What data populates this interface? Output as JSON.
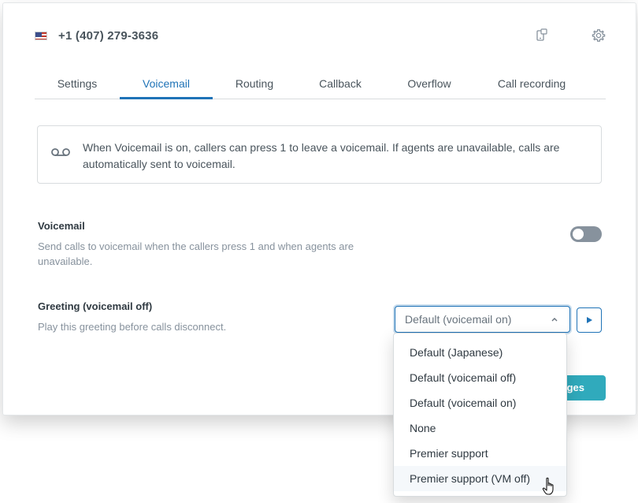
{
  "header": {
    "flag": "us-flag-icon",
    "phone_number": "+1 (407) 279-3636",
    "icons": [
      "mobile-device-icon",
      "gear-icon"
    ]
  },
  "tabs": [
    {
      "label": "Settings",
      "active": false
    },
    {
      "label": "Voicemail",
      "active": true
    },
    {
      "label": "Routing",
      "active": false
    },
    {
      "label": "Callback",
      "active": false
    },
    {
      "label": "Overflow",
      "active": false
    },
    {
      "label": "Call recording",
      "active": false
    }
  ],
  "info": {
    "icon": "voicemail-icon",
    "text": "When Voicemail is on, callers can press 1 to leave a voicemail. If agents are unavailable, calls are automatically sent to voicemail."
  },
  "voicemail_setting": {
    "label": "Voicemail",
    "description": "Send calls to voicemail when the callers press 1 and when agents are unavailable.",
    "toggle_on": false
  },
  "greeting_setting": {
    "label": "Greeting (voicemail off)",
    "description": "Play this greeting before calls disconnect.",
    "selected_value": "Default (voicemail on)",
    "options": [
      "Default (Japanese)",
      "Default (voicemail off)",
      "Default (voicemail on)",
      "None",
      "Premier support",
      "Premier support (VM off)"
    ],
    "hovered_option": "Premier support (VM off)"
  },
  "save_button": {
    "visible_label": "ges"
  },
  "colors": {
    "accent_blue": "#1f73b7",
    "save_button": "#30aabc",
    "toggle_off": "#87929d",
    "text_muted": "#87929d"
  }
}
